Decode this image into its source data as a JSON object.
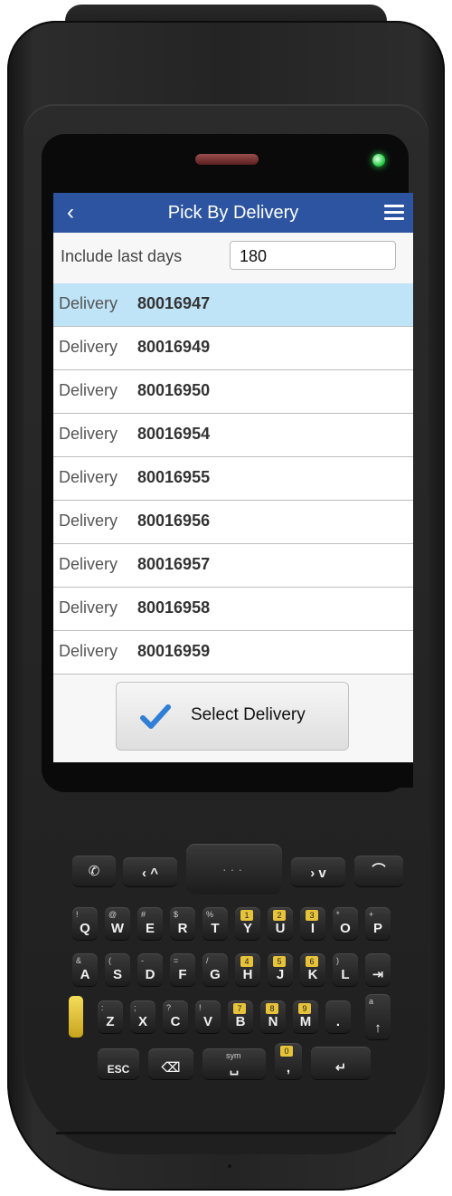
{
  "app": {
    "title": "Pick By Delivery",
    "back_icon": "back-icon",
    "menu_icon": "menu-icon"
  },
  "filter": {
    "label": "Include last days",
    "value": "180"
  },
  "deliveries": [
    {
      "label": "Delivery",
      "number": "80016947",
      "selected": true
    },
    {
      "label": "Delivery",
      "number": "80016949",
      "selected": false
    },
    {
      "label": "Delivery",
      "number": "80016950",
      "selected": false
    },
    {
      "label": "Delivery",
      "number": "80016954",
      "selected": false
    },
    {
      "label": "Delivery",
      "number": "80016955",
      "selected": false
    },
    {
      "label": "Delivery",
      "number": "80016956",
      "selected": false
    },
    {
      "label": "Delivery",
      "number": "80016957",
      "selected": false
    },
    {
      "label": "Delivery",
      "number": "80016958",
      "selected": false
    },
    {
      "label": "Delivery",
      "number": "80016959",
      "selected": false
    }
  ],
  "actions": {
    "select_label": "Select Delivery",
    "select_icon": "check-icon"
  },
  "keypad": {
    "top_row": [
      "call",
      "nav-left",
      "nav-center",
      "nav-right",
      "end"
    ],
    "row1": [
      {
        "main": "Q",
        "sub": "!"
      },
      {
        "main": "W",
        "sub": "@"
      },
      {
        "main": "E",
        "sub": "#"
      },
      {
        "main": "R",
        "sub": "$"
      },
      {
        "main": "T",
        "sub": "%"
      },
      {
        "main": "Y",
        "sub": "1"
      },
      {
        "main": "U",
        "sub": "2"
      },
      {
        "main": "I",
        "sub": "3"
      },
      {
        "main": "O",
        "sub": "*"
      },
      {
        "main": "P",
        "sub": "+"
      }
    ],
    "row2": [
      {
        "main": "A",
        "sub": "&"
      },
      {
        "main": "S",
        "sub": "("
      },
      {
        "main": "D",
        "sub": "-"
      },
      {
        "main": "F",
        "sub": "="
      },
      {
        "main": "G",
        "sub": "/"
      },
      {
        "main": "H",
        "sub": "4"
      },
      {
        "main": "J",
        "sub": "5"
      },
      {
        "main": "K",
        "sub": "6"
      },
      {
        "main": "L",
        "sub": ")"
      },
      {
        "main": "⇥",
        "sub": ""
      }
    ],
    "row3": [
      {
        "main": "Z",
        "sub": ":"
      },
      {
        "main": "X",
        "sub": ";"
      },
      {
        "main": "C",
        "sub": "?"
      },
      {
        "main": "V",
        "sub": "!"
      },
      {
        "main": "B",
        "sub": "7"
      },
      {
        "main": "N",
        "sub": "8"
      },
      {
        "main": "M",
        "sub": "9"
      },
      {
        "main": ".",
        "sub": ""
      },
      {
        "main": "↑",
        "sub": "a"
      }
    ],
    "row4": [
      {
        "main": "ESC",
        "sub": ""
      },
      {
        "main": "⌫",
        "sub": ""
      },
      {
        "main": "␣",
        "sub": "sym"
      },
      {
        "main": ",",
        "sub": "0"
      },
      {
        "main": "↵",
        "sub": ""
      }
    ],
    "yellow_digit_keys": [
      "Y",
      "U",
      "I",
      "H",
      "J",
      "K",
      "B",
      "N",
      "M",
      ","
    ]
  }
}
